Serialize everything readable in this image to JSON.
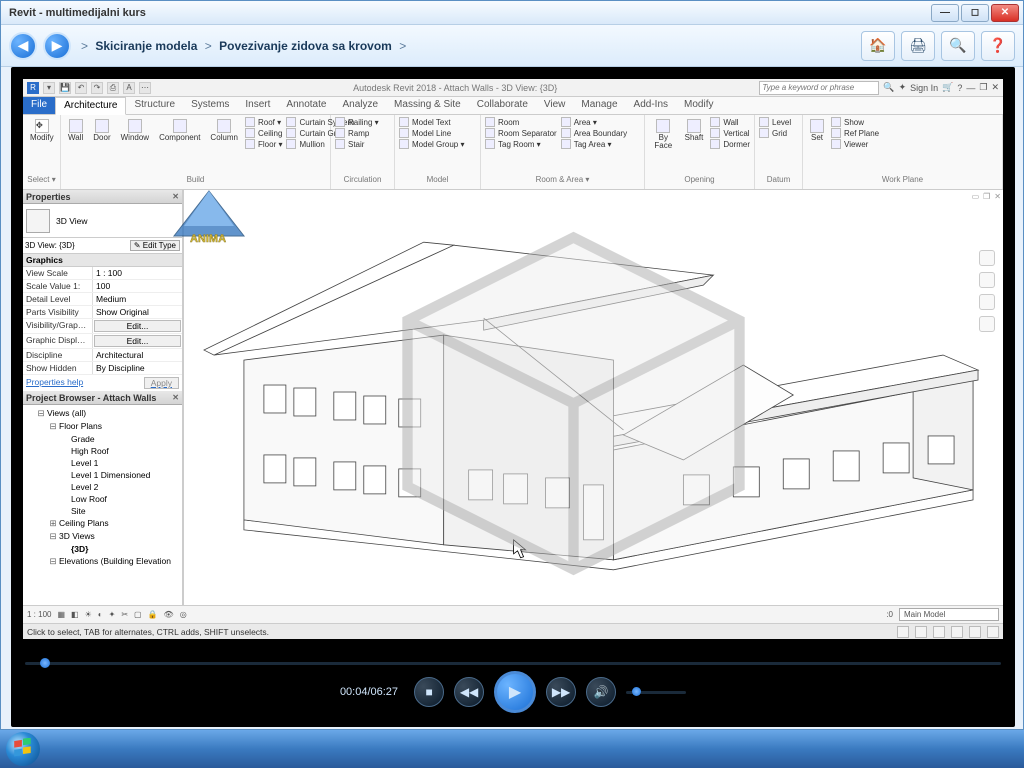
{
  "player": {
    "title": "Revit - multimedijalni kurs",
    "breadcrumb": {
      "sep": ">",
      "item1": "Skiciranje modela",
      "item2": "Povezivanje zidova sa krovom"
    },
    "time": "00:04/06:27"
  },
  "revit": {
    "app_title": "Autodesk Revit 2018 - Attach Walls - 3D View: {3D}",
    "search_placeholder": "Type a keyword or phrase",
    "signin": "Sign In",
    "tabs": [
      "File",
      "Architecture",
      "Structure",
      "Systems",
      "Insert",
      "Annotate",
      "Analyze",
      "Massing & Site",
      "Collaborate",
      "View",
      "Manage",
      "Add-Ins",
      "Modify"
    ],
    "active_tab": "Architecture",
    "ribbon": {
      "select": "Select ▾",
      "modify": "Modify",
      "build_group": "Build",
      "build": [
        "Wall",
        "Door",
        "Window",
        "Component",
        "Column"
      ],
      "build_side": [
        "Roof ▾",
        "Ceiling",
        "Floor ▾",
        "Curtain System",
        "Curtain Grid",
        "Mullion"
      ],
      "circulation_group": "Circulation",
      "circulation": [
        "Railing ▾",
        "Ramp",
        "Stair"
      ],
      "model_group": "Model",
      "model": [
        "Model Text",
        "Model Line",
        "Model Group ▾"
      ],
      "room_group": "Room & Area ▾",
      "room": [
        "Room",
        "Room Separator",
        "Tag Room ▾",
        "Area ▾",
        "Area Boundary",
        "Tag Area ▾"
      ],
      "opening_group": "Opening",
      "opening": [
        "By Face",
        "Shaft",
        "Wall",
        "Vertical",
        "Dormer"
      ],
      "datum_group": "Datum",
      "datum": [
        "Level",
        "Grid"
      ],
      "workplane_group": "Work Plane",
      "workplane": [
        "Set",
        "Show",
        "Ref Plane",
        "Viewer"
      ]
    },
    "properties": {
      "panel_title": "Properties",
      "type": "3D View",
      "selector": "3D View: {3D}",
      "edit_type": "✎ Edit Type",
      "cat": "Graphics",
      "rows": [
        {
          "k": "View Scale",
          "v": "1 : 100"
        },
        {
          "k": "Scale Value   1:",
          "v": "100"
        },
        {
          "k": "Detail Level",
          "v": "Medium"
        },
        {
          "k": "Parts Visibility",
          "v": "Show Original"
        },
        {
          "k": "Visibility/Grap…",
          "v": "Edit...",
          "btn": true
        },
        {
          "k": "Graphic Displ…",
          "v": "Edit...",
          "btn": true
        },
        {
          "k": "Discipline",
          "v": "Architectural"
        },
        {
          "k": "Show Hidden",
          "v": "By Discipline"
        }
      ],
      "help": "Properties help",
      "apply": "Apply"
    },
    "browser": {
      "title": "Project Browser - Attach Walls",
      "tree": [
        {
          "l": 1,
          "exp": "⊟",
          "t": "Views (all)"
        },
        {
          "l": 2,
          "exp": "⊟",
          "t": "Floor Plans"
        },
        {
          "l": 3,
          "t": "Grade"
        },
        {
          "l": 3,
          "t": "High Roof"
        },
        {
          "l": 3,
          "t": "Level 1"
        },
        {
          "l": 3,
          "t": "Level 1 Dimensioned"
        },
        {
          "l": 3,
          "t": "Level 2"
        },
        {
          "l": 3,
          "t": "Low Roof"
        },
        {
          "l": 3,
          "t": "Site"
        },
        {
          "l": 2,
          "exp": "⊞",
          "t": "Ceiling Plans"
        },
        {
          "l": 2,
          "exp": "⊟",
          "t": "3D Views"
        },
        {
          "l": 3,
          "t": "{3D}",
          "sel": true
        },
        {
          "l": 2,
          "exp": "⊟",
          "t": "Elevations (Building Elevation"
        }
      ]
    },
    "status": "Click to select, TAB for alternates, CTRL adds, SHIFT unselects.",
    "main_model": "Main Model",
    "scale": "1 : 100",
    "vb_page": ":0"
  }
}
